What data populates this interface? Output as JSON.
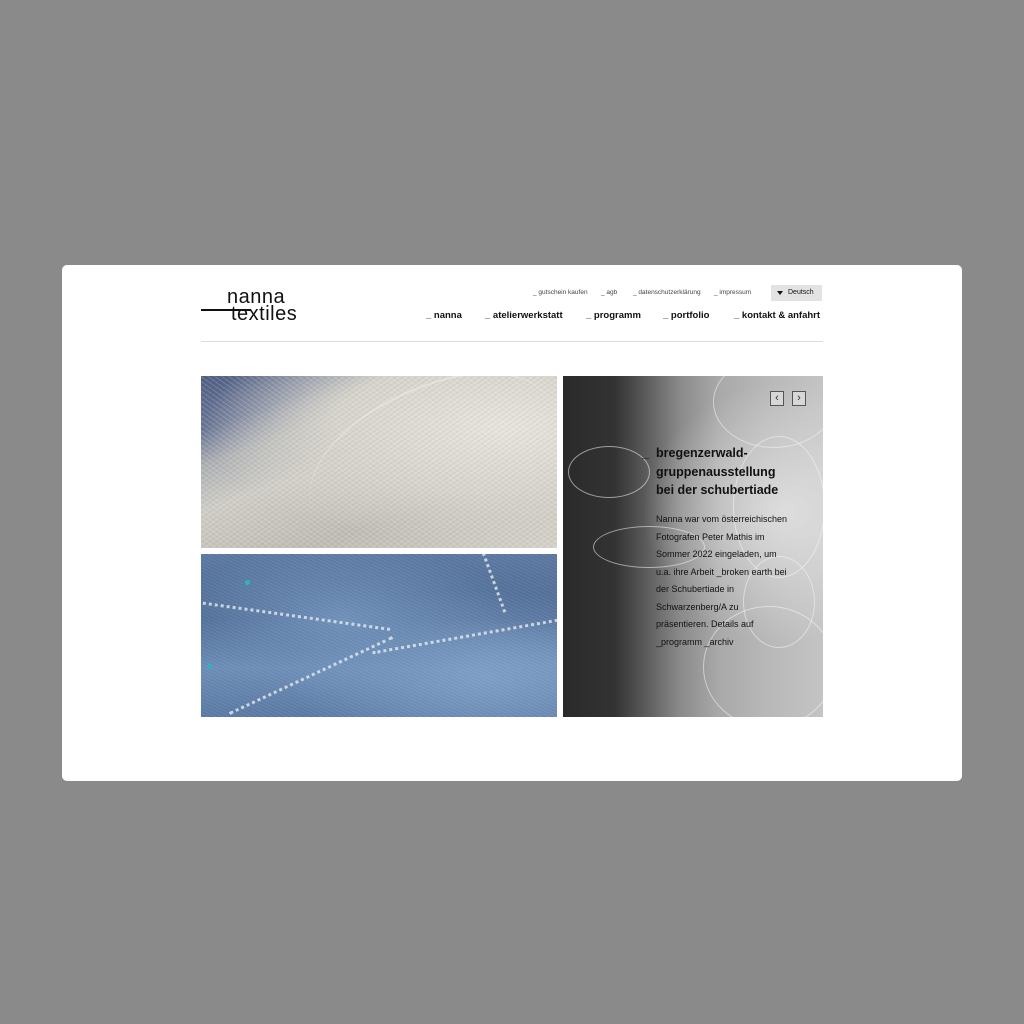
{
  "logo": {
    "line1": "nanna",
    "line2": "textiles"
  },
  "utility_links": [
    "_ gutschein kaufen",
    "_ agb",
    "_ datenschutzerklärung",
    "_ impressum"
  ],
  "language": {
    "selected": "Deutsch"
  },
  "nav": [
    "_ nanna",
    "_ atelierwerkstatt",
    "_ programm",
    "_ portfolio",
    "_ kontakt & anfahrt"
  ],
  "slider": {
    "prev": "‹",
    "next": "›",
    "dash": "_",
    "title_lines": [
      "bregenzerwald-",
      "gruppenausstellung",
      "bei der schubertiade"
    ],
    "body_lines": [
      "Nanna war vom österreichischen",
      "Fotografen Peter Mathis im",
      "Sommer 2022 eingeladen, um",
      "u.a. ihre Arbeit _broken earth bei",
      "der Schubertiade in",
      "Schwarzenberg/A zu",
      "präsentieren. Details auf",
      "_programm _archiv"
    ]
  },
  "colors": {
    "page_bg": "#8a8a8a",
    "card_bg": "#ffffff",
    "text": "#111111",
    "lang_bg": "#e3e3e3"
  }
}
